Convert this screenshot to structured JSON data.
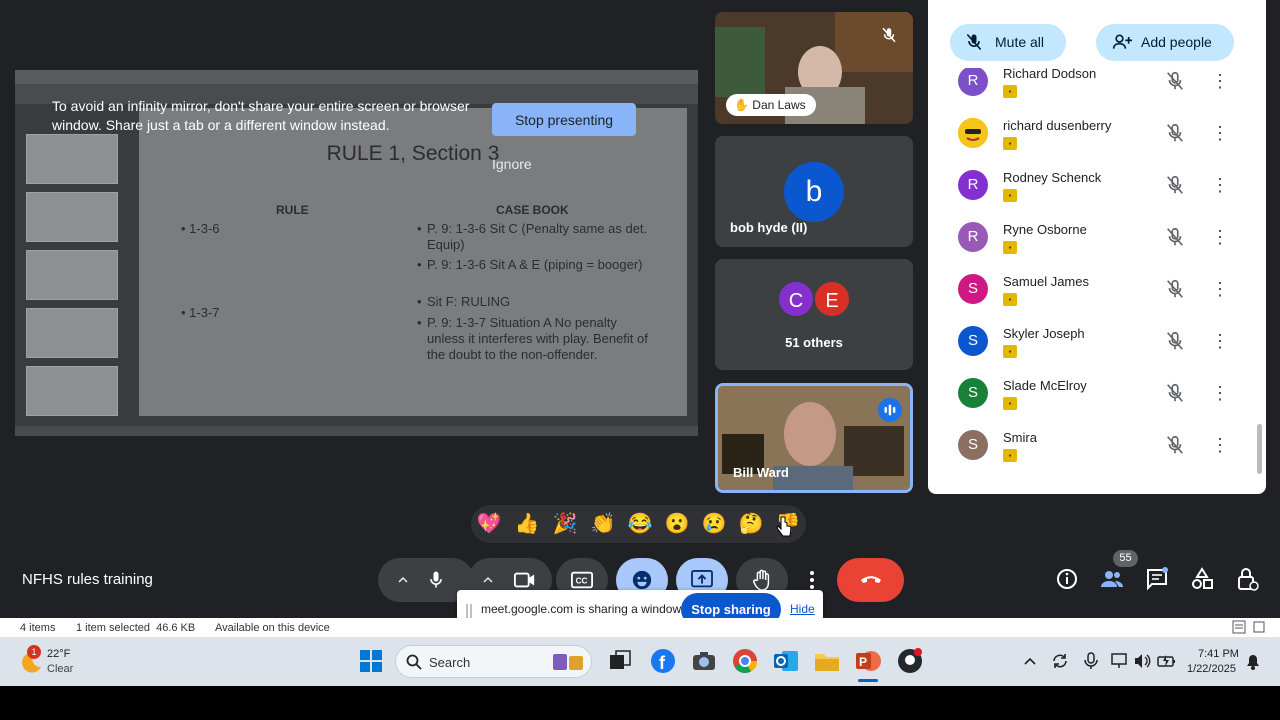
{
  "presentation": {
    "warning": "To avoid an infinity mirror, don't share your entire screen or browser window. Share just a tab or a different window instead.",
    "stop_presenting": "Stop presenting",
    "ignore": "Ignore",
    "slide": {
      "title": "RULE 1, Section 3",
      "col_rule": "RULE",
      "col_case": "CASE BOOK",
      "rules": [
        "1-3-6",
        "1-3-7"
      ],
      "cases": [
        "P. 9: 1-3-6 Sit C (Penalty same as det. Equip)",
        "P. 9: 1-3-6 Sit A & E (piping = booger)",
        "Sit F: RULING",
        "P. 9: 1-3-7 Situation A No penalty unless it interferes with play. Benefit of the doubt to the non-offender."
      ]
    }
  },
  "tiles": {
    "dan": {
      "name": "Dan Laws"
    },
    "bob": {
      "initial": "b",
      "name": "bob hyde (II)",
      "color": "#0b57d0"
    },
    "others": {
      "initials": [
        "C",
        "E"
      ],
      "label": "51 others",
      "colors": [
        "#8430ce",
        "#d93025"
      ]
    },
    "bill": {
      "name": "Bill Ward"
    }
  },
  "panel": {
    "mute_all": "Mute all",
    "add_people": "Add people",
    "participants": [
      {
        "initial": "R",
        "name": "Richard Dodson",
        "color": "#7b50c9"
      },
      {
        "initial": "",
        "name": "richard dusenberry",
        "color": "#f5c518"
      },
      {
        "initial": "R",
        "name": "Rodney Schenck",
        "color": "#8430ce"
      },
      {
        "initial": "R",
        "name": "Ryne Osborne",
        "color": "#9b59b6"
      },
      {
        "initial": "S",
        "name": "Samuel James",
        "color": "#d01884"
      },
      {
        "initial": "S",
        "name": "Skyler Joseph",
        "color": "#0b57d0"
      },
      {
        "initial": "S",
        "name": "Slade McElroy",
        "color": "#188038"
      },
      {
        "initial": "S",
        "name": "Smira",
        "color": "#8d6e63"
      }
    ]
  },
  "reactions": [
    "💖",
    "👍",
    "🎉",
    "👏",
    "😂",
    "😮",
    "😢",
    "🤔",
    "👎"
  ],
  "meeting": {
    "title": "NFHS rules training",
    "participant_count": "55"
  },
  "sharing": {
    "text": "meet.google.com is sharing a window.",
    "stop": "Stop sharing",
    "hide": "Hide"
  },
  "explorer": {
    "items": "4 items",
    "selected": "1 item selected  46.6 KB",
    "availability": "Available on this device"
  },
  "taskbar": {
    "weather_temp": "22°F",
    "weather_cond": "Clear",
    "weather_badge": "1",
    "search": "Search",
    "time": "7:41 PM",
    "date": "1/22/2025"
  }
}
